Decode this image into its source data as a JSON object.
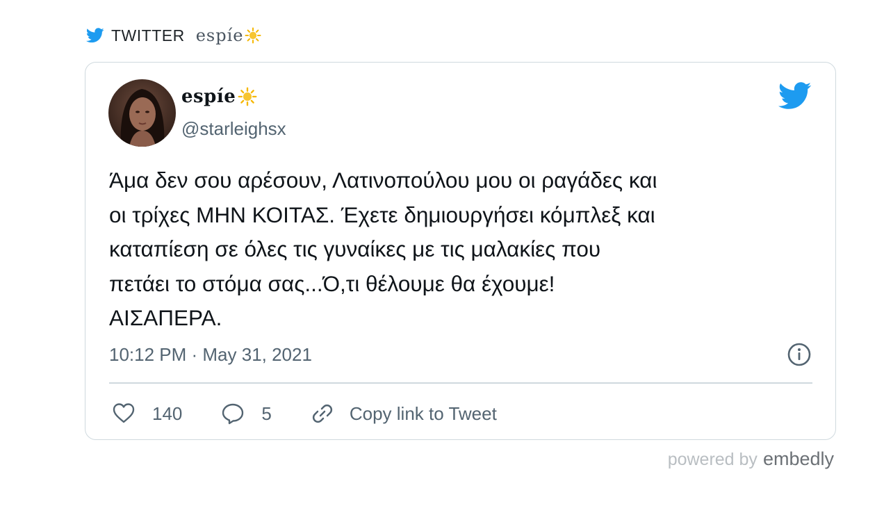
{
  "source": {
    "label": "TWITTER",
    "author": "espíe"
  },
  "tweet": {
    "display_name": "espíe",
    "handle": "@starleighsx",
    "text": "Άμα δεν σου αρέσουν, Λατινοπούλου μου οι ραγάδες και\nοι τρίχες ΜΗΝ ΚΟΙΤΑΣ. Έχετε δημιουργήσει κόμπλεξ και\nκαταπίεση σε όλες τις γυναίκες με τις μαλακίες που\nπετάει το στόμα σας...Ό,τι θέλουμε θα έχουμε!\nΑΙΣΑΠΕΡΑ.",
    "timestamp": "10:12 PM · May 31, 2021",
    "likes": "140",
    "replies": "5",
    "copy_link_label": "Copy link to Tweet"
  },
  "footer": {
    "powered_by": "powered by",
    "brand": "embedly"
  },
  "icons": {
    "source_bird": "twitter-bird-icon",
    "card_logo": "twitter-logo-icon",
    "info": "info-icon",
    "like": "heart-icon",
    "reply": "reply-bubble-icon",
    "link": "link-icon",
    "emoji": "sun-emoji"
  },
  "colors": {
    "twitter_blue": "#1d9bf0",
    "text_primary": "#0f1419",
    "text_secondary": "#536471",
    "border": "#cfd9de",
    "sun": "#f5b700"
  }
}
